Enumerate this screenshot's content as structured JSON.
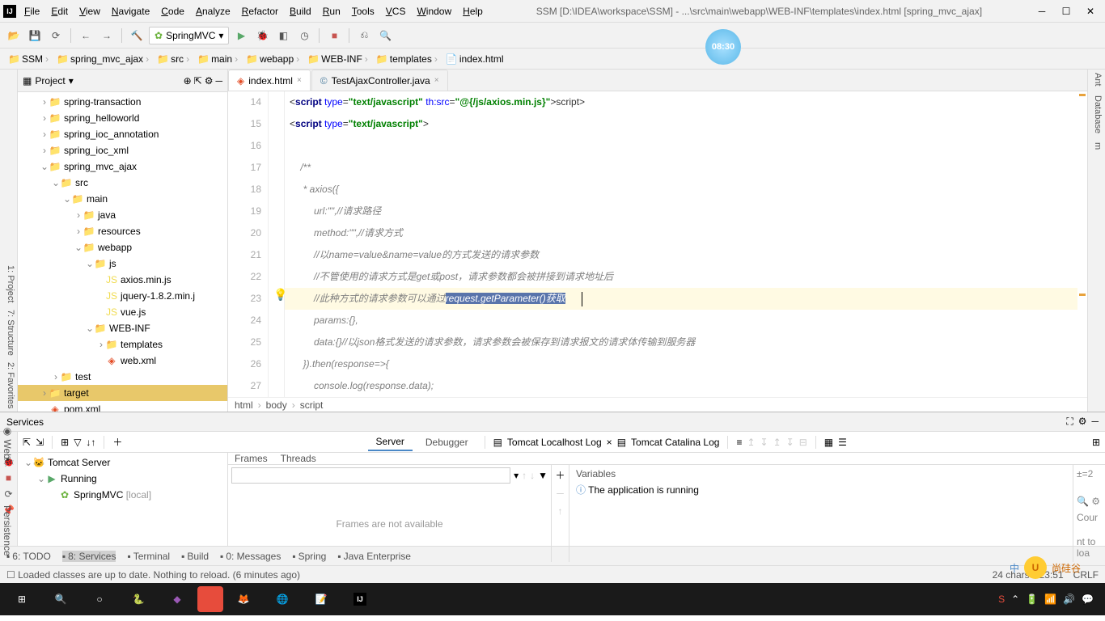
{
  "title": {
    "project": "SSM",
    "path": "[D:\\IDEA\\workspace\\SSM] - ...\\src\\main\\webapp\\WEB-INF\\templates\\index.html [spring_mvc_ajax]"
  },
  "menu": [
    "File",
    "Edit",
    "View",
    "Navigate",
    "Code",
    "Analyze",
    "Refactor",
    "Build",
    "Run",
    "Tools",
    "VCS",
    "Window",
    "Help"
  ],
  "run_config": "SpringMVC",
  "nav": [
    "SSM",
    "spring_mvc_ajax",
    "src",
    "main",
    "webapp",
    "WEB-INF",
    "templates",
    "index.html"
  ],
  "project_panel_title": "Project",
  "tree": [
    {
      "d": 2,
      "a": "›",
      "i": "folder",
      "t": "spring-transaction"
    },
    {
      "d": 2,
      "a": "›",
      "i": "folder",
      "t": "spring_helloworld"
    },
    {
      "d": 2,
      "a": "›",
      "i": "folder",
      "t": "spring_ioc_annotation"
    },
    {
      "d": 2,
      "a": "›",
      "i": "folder",
      "t": "spring_ioc_xml"
    },
    {
      "d": 2,
      "a": "⌄",
      "i": "folder",
      "t": "spring_mvc_ajax"
    },
    {
      "d": 3,
      "a": "⌄",
      "i": "folder",
      "t": "src"
    },
    {
      "d": 4,
      "a": "⌄",
      "i": "folder",
      "t": "main"
    },
    {
      "d": 5,
      "a": "›",
      "i": "folder",
      "t": "java"
    },
    {
      "d": 5,
      "a": "›",
      "i": "folder",
      "t": "resources"
    },
    {
      "d": 5,
      "a": "⌄",
      "i": "folder",
      "t": "webapp"
    },
    {
      "d": 6,
      "a": "⌄",
      "i": "folder",
      "t": "js"
    },
    {
      "d": 7,
      "a": "",
      "i": "js",
      "t": "axios.min.js"
    },
    {
      "d": 7,
      "a": "",
      "i": "js",
      "t": "jquery-1.8.2.min.j"
    },
    {
      "d": 7,
      "a": "",
      "i": "js",
      "t": "vue.js"
    },
    {
      "d": 6,
      "a": "⌄",
      "i": "folder",
      "t": "WEB-INF"
    },
    {
      "d": 7,
      "a": "›",
      "i": "folder",
      "t": "templates"
    },
    {
      "d": 7,
      "a": "",
      "i": "xml",
      "t": "web.xml"
    },
    {
      "d": 3,
      "a": "›",
      "i": "folder",
      "t": "test"
    },
    {
      "d": 2,
      "a": "›",
      "i": "folder",
      "t": "target",
      "sel": true
    },
    {
      "d": 2,
      "a": "",
      "i": "xml",
      "t": "pom.xml"
    }
  ],
  "editor_tabs": [
    {
      "label": "index.html",
      "icon": "html",
      "active": true
    },
    {
      "label": "TestAjaxController.java",
      "icon": "java",
      "active": false
    }
  ],
  "gutter_lines": [
    "14",
    "15",
    "16",
    "17",
    "18",
    "19",
    "20",
    "21",
    "22",
    "23",
    "24",
    "25",
    "26",
    "27"
  ],
  "code": {
    "l14": {
      "pre": "<",
      "tag": "script",
      "sp": " ",
      "a1": "type",
      "eq": "=",
      "v1": "\"text/javascript\"",
      "sp2": " ",
      "a2": "th:src",
      "eq2": "=",
      "v2": "\"@{/js/axios.min.js}\"",
      "post": "></",
      "tag2": "script",
      "end": ">"
    },
    "l15": {
      "pre": "<",
      "tag": "script",
      "sp": " ",
      "a1": "type",
      "eq": "=",
      "v1": "\"text/javascript\"",
      "end": ">"
    },
    "l17": "    /**",
    "l18": "     * axios({",
    "l19": "         url:\"\",//请求路径",
    "l20": "         method:\"\",//请求方式",
    "l21": "         //以name=value&name=value的方式发送的请求参数",
    "l22": "         //不管使用的请求方式是get或post，请求参数都会被拼接到请求地址后",
    "l23_pre": "         //此种方式的请求参数可以通过",
    "l23_sel": "request.getParameter()获取",
    "l24": "         params:{},",
    "l25": "         data:{}//以json格式发送的请求参数，请求参数会被保存到请求报文的请求体传输到服务器",
    "l26": "     }).then(response=>{",
    "l27": "         console.log(response.data);"
  },
  "breadcrumb": [
    "html",
    "body",
    "script"
  ],
  "services_title": "Services",
  "svc_tree": [
    {
      "d": 0,
      "a": "⌄",
      "i": "tomcat",
      "t": "Tomcat Server"
    },
    {
      "d": 1,
      "a": "⌄",
      "i": "run",
      "t": "Running"
    },
    {
      "d": 2,
      "a": "",
      "i": "spring",
      "t": "SpringMVC",
      "suffix": " [local]"
    }
  ],
  "svc_tabs": [
    "Server",
    "Debugger"
  ],
  "svc_logtabs": [
    "Tomcat Localhost Log",
    "Tomcat Catalina Log"
  ],
  "svc_subtabs": [
    "Frames",
    "Threads"
  ],
  "vars_title": "Variables",
  "vars_msg": "The application is running",
  "frames_msg": "Frames are not available",
  "side_right": "Cour",
  "side_right2": "nt to loa",
  "bottom_tools": [
    "6: TODO",
    "8: Services",
    "Terminal",
    "Build",
    "0: Messages",
    "Spring",
    "Java Enterprise"
  ],
  "status_msg": "Loaded classes are up to date. Nothing to reload. (6 minutes ago)",
  "status_right": {
    "chars": "24 chars",
    "pos": "23:51",
    "enc": "CRLF"
  },
  "clock": "08:30",
  "logo_text": "尚硅谷"
}
